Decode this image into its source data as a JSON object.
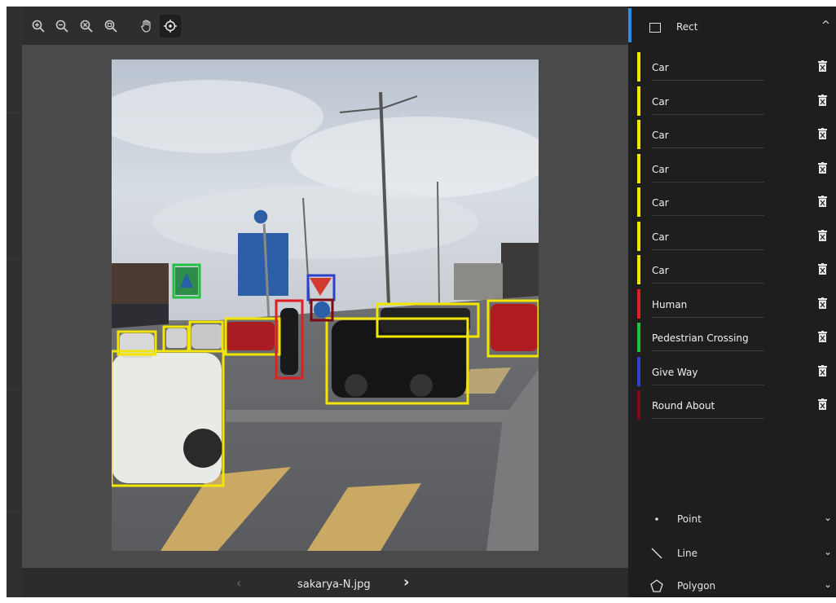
{
  "toolbar": {
    "tools": [
      {
        "name": "zoom-in-icon"
      },
      {
        "name": "zoom-out-icon"
      },
      {
        "name": "zoom-reset-icon"
      },
      {
        "name": "zoom-fit-icon"
      },
      {
        "name": "pan-hand-icon"
      },
      {
        "name": "select-target-icon",
        "active": true
      }
    ]
  },
  "viewer": {
    "filename": "sakarya-N.jpg",
    "prev_glyph": "‹",
    "next_glyph": "›"
  },
  "sidebar": {
    "section_title": "Rect",
    "accent_color": "#2d8cdc",
    "annotations": [
      {
        "label": "Car",
        "color": "#f2e600"
      },
      {
        "label": "Car",
        "color": "#f2e600"
      },
      {
        "label": "Car",
        "color": "#f2e600"
      },
      {
        "label": "Car",
        "color": "#f2e600"
      },
      {
        "label": "Car",
        "color": "#f2e600"
      },
      {
        "label": "Car",
        "color": "#f2e600"
      },
      {
        "label": "Car",
        "color": "#f2e600"
      },
      {
        "label": "Human",
        "color": "#e02020"
      },
      {
        "label": "Pedestrian Crossing",
        "color": "#22c040"
      },
      {
        "label": "Give Way",
        "color": "#3040c8"
      },
      {
        "label": "Round About",
        "color": "#7a0a14"
      }
    ],
    "tools": [
      {
        "label": "Point",
        "icon": "point-icon"
      },
      {
        "label": "Line",
        "icon": "line-icon"
      },
      {
        "label": "Polygon",
        "icon": "polygon-icon"
      }
    ]
  }
}
